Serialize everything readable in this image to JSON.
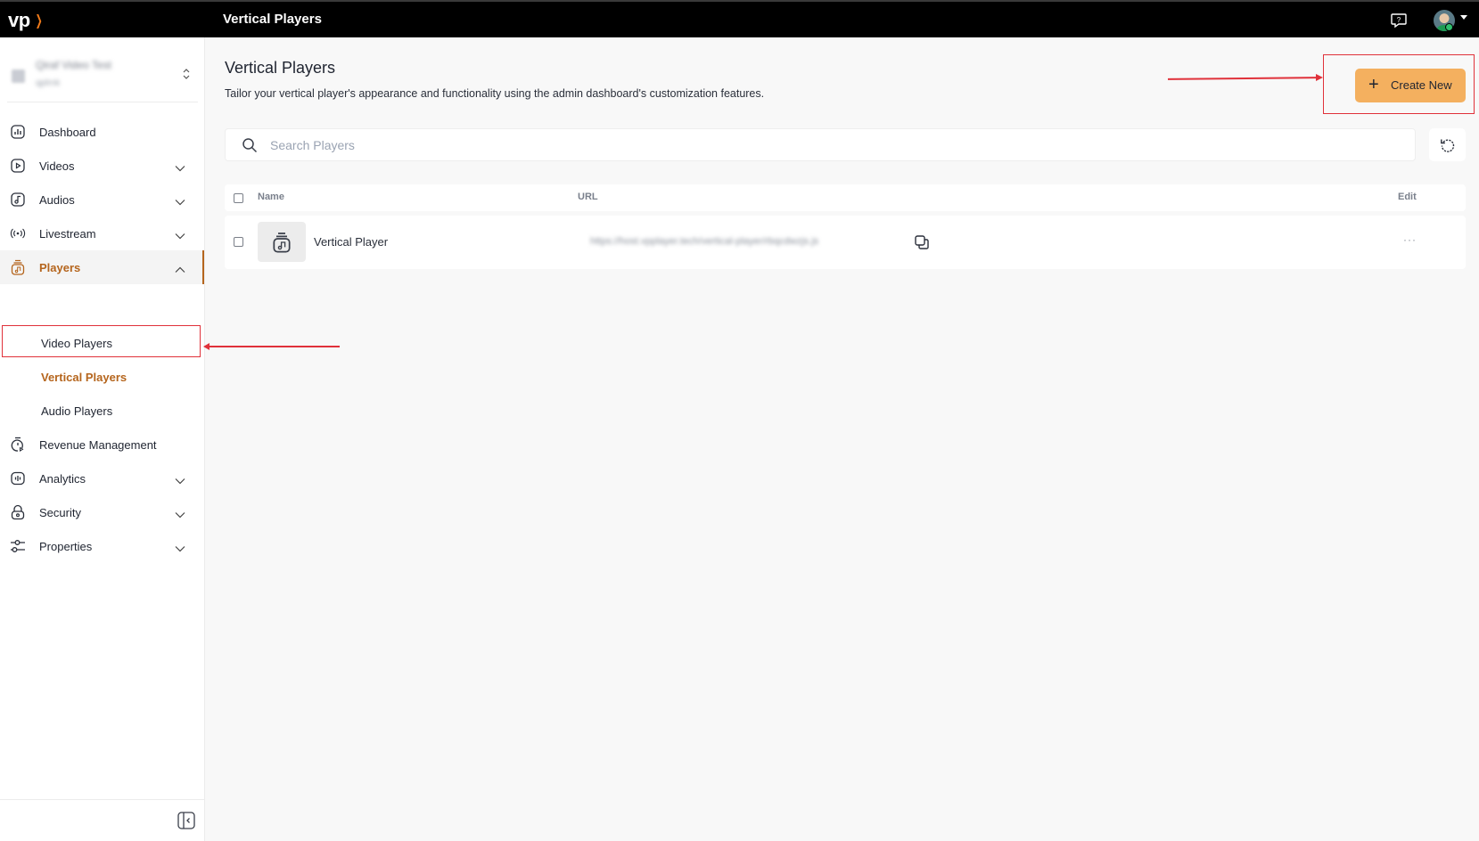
{
  "topbar": {
    "logo_text": "vp",
    "app_title": "Vertical Players",
    "help_icon": "help-chat-icon",
    "avatar_icon": "user-avatar"
  },
  "sidebar": {
    "workspace": {
      "name": "Qiraf Video Test",
      "sub": "qplrnk"
    },
    "items": [
      {
        "label": "Dashboard",
        "icon": "dashboard-icon",
        "expandable": false
      },
      {
        "label": "Videos",
        "icon": "video-icon",
        "expandable": true
      },
      {
        "label": "Audios",
        "icon": "audio-icon",
        "expandable": true
      },
      {
        "label": "Livestream",
        "icon": "livestream-icon",
        "expandable": true
      },
      {
        "label": "Players",
        "icon": "player-icon",
        "expandable": true,
        "expanded": true,
        "active": true
      },
      {
        "label": "Revenue Management",
        "icon": "revenue-icon",
        "expandable": false
      },
      {
        "label": "Analytics",
        "icon": "analytics-icon",
        "expandable": true
      },
      {
        "label": "Security",
        "icon": "lock-icon",
        "expandable": true
      },
      {
        "label": "Properties",
        "icon": "sliders-icon",
        "expandable": true
      }
    ],
    "players_sub": [
      {
        "label": "Video Players"
      },
      {
        "label": "Vertical Players",
        "active": true
      },
      {
        "label": "Audio Players"
      }
    ]
  },
  "main": {
    "title": "Vertical Players",
    "description": "Tailor your vertical player's appearance and functionality using the admin dashboard's customization features.",
    "create_button": "Create New",
    "search_placeholder": "Search Players",
    "table": {
      "columns": [
        "Name",
        "URL",
        "Edit"
      ],
      "rows": [
        {
          "name": "Vertical Player",
          "url": "https://host.vpplayer.tech/vertical-player/rbqcdwzjs.js",
          "edit": "···"
        }
      ]
    }
  },
  "colors": {
    "accent": "#b5651d",
    "button": "#f4b05f",
    "annotation": "#e0313a",
    "topbar": "#000000"
  }
}
